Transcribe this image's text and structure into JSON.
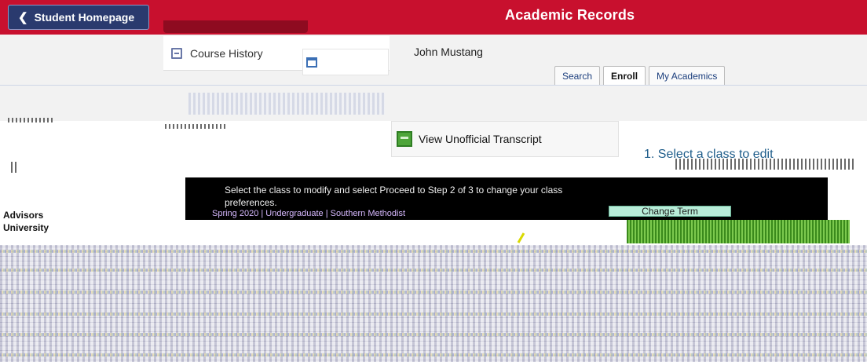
{
  "header": {
    "back_label": "Student Homepage",
    "title": "Academic Records"
  },
  "nav": {
    "course_history": "Course History"
  },
  "student": {
    "name": "John Mustang"
  },
  "tabs": [
    "Search",
    "Enroll",
    "My Academics"
  ],
  "active_tab": "Enroll",
  "links": {
    "view_transcript": "View Unofficial Transcript"
  },
  "enrollment": {
    "step_label": "1.  Select a class to edit",
    "message_line1": "Select the class to modify and select Proceed to Step 2 of 3 to change your class",
    "message_line2": "preferences.",
    "term": "Spring 2020 | Undergraduate | Southern Methodist",
    "change_term_button": "Change Term"
  },
  "advisors": {
    "label": "Advisors",
    "university": "University"
  },
  "colors": {
    "header_bg": "#c8102e",
    "back_button_bg": "#2a3a6e",
    "transcript_icon": "#4ea53a",
    "change_term_bg": "#b8ecd8",
    "progress": "#5fb33a"
  },
  "icons": {
    "back": "chevron-left-icon",
    "course_history": "document-icon",
    "search": "calendar-icon",
    "transcript": "transcript-icon"
  }
}
